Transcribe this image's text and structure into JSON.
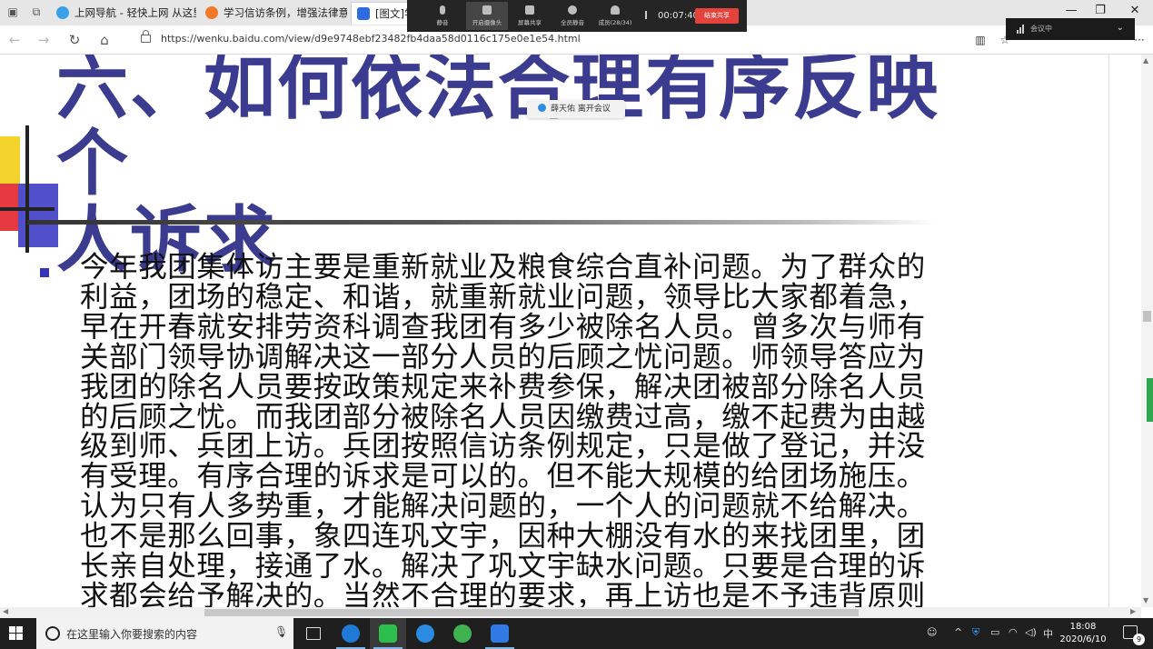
{
  "browser": {
    "tabs": [
      {
        "label": "上网导航 - 轻快上网 从这里"
      },
      {
        "label": "学习信访条例，增强法律意"
      },
      {
        "label": "[图文]学"
      }
    ],
    "url": "https://wenku.baidu.com/view/d9e9748ebf23482fb4daa58d0116c175e0e1e54.html"
  },
  "meeting": {
    "buttons": [
      {
        "label": "静音"
      },
      {
        "label": "开启摄像头"
      },
      {
        "label": "屏幕共享"
      },
      {
        "label": "全员静音"
      },
      {
        "label": "成员(28/34)"
      }
    ],
    "timer": "00:07:40",
    "end_label": "结束共享",
    "status": "会议中",
    "toast": "薛天佑 离开会议"
  },
  "document": {
    "title_line1": "六、如何依法合理有序反映个",
    "title_line2": "人诉求",
    "paragraph_lines": [
      "今年我团集体访主要是重新就业及粮食综合直补问题。为了群众的",
      "利益，团场的稳定、和谐，就重新就业问题，领导比大家都着急，",
      "早在开春就安排劳资科调查我团有多少被除名人员。曾多次与师有",
      "关部门领导协调解决这一部分人员的后顾之忧问题。师领导答应为",
      "我团的除名人员要按政策规定来补费参保，解决团被部分除名人员",
      "的后顾之忧。而我团部分被除名人员因缴费过高，缴不起费为由越",
      "级到师、兵团上访。兵团按照信访条例规定，只是做了登记，并没",
      "有受理。有序合理的诉求是可以的。但不能大规模的给团场施压。",
      "认为只有人多势重，才能解决问题的，一个人的问题就不给解决。",
      "也不是那么回事，象四连巩文宇，因种大棚没有水的来找团里，团",
      "长亲自处理，接通了水。解决了巩文宇缺水问题。只要是合理的诉",
      "求都会给予解决的。当然不合理的要求，再上访也是不予违背原则"
    ]
  },
  "taskbar": {
    "search_placeholder": "在这里输入你要搜索的内容",
    "ime": "中",
    "time": "18:08",
    "date": "2020/6/10",
    "notification_count": "9"
  },
  "colors": {
    "title_blue": "#3b3b90",
    "meeting_end_red": "#e4433b",
    "taskbar_bg": "#1f1f1f"
  }
}
